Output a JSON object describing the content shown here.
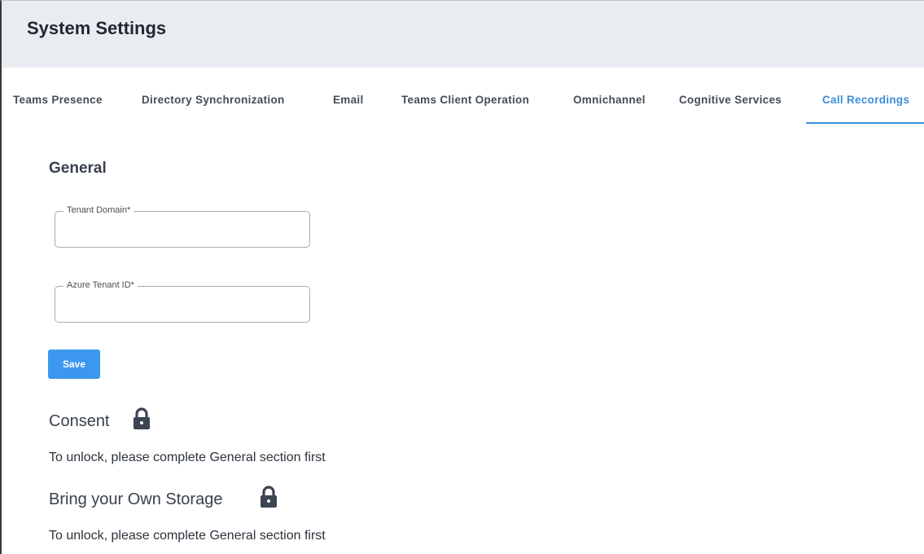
{
  "header": {
    "title": "System Settings"
  },
  "tabs": [
    {
      "label": "Teams Presence",
      "active": false
    },
    {
      "label": "Directory Synchronization",
      "active": false
    },
    {
      "label": "Email",
      "active": false
    },
    {
      "label": "Teams Client Operation",
      "active": false
    },
    {
      "label": "Omnichannel",
      "active": false
    },
    {
      "label": "Cognitive Services",
      "active": false
    },
    {
      "label": "Call Recordings",
      "active": true
    }
  ],
  "general": {
    "title": "General",
    "tenant_domain": {
      "label": "Tenant Domain*",
      "value": ""
    },
    "azure_tenant_id": {
      "label": "Azure Tenant ID*",
      "value": ""
    },
    "save_label": "Save"
  },
  "consent": {
    "title": "Consent",
    "locked": true,
    "note": "To unlock, please complete General section first"
  },
  "storage": {
    "title": "Bring your Own Storage",
    "locked": true,
    "note": "To unlock, please complete General section first"
  },
  "colors": {
    "accent": "#3a8fd9",
    "button": "#3b98ee",
    "header_bg": "#e9edf1",
    "lock": "#3d4452"
  },
  "icons": {
    "lock": "lock-icon"
  }
}
